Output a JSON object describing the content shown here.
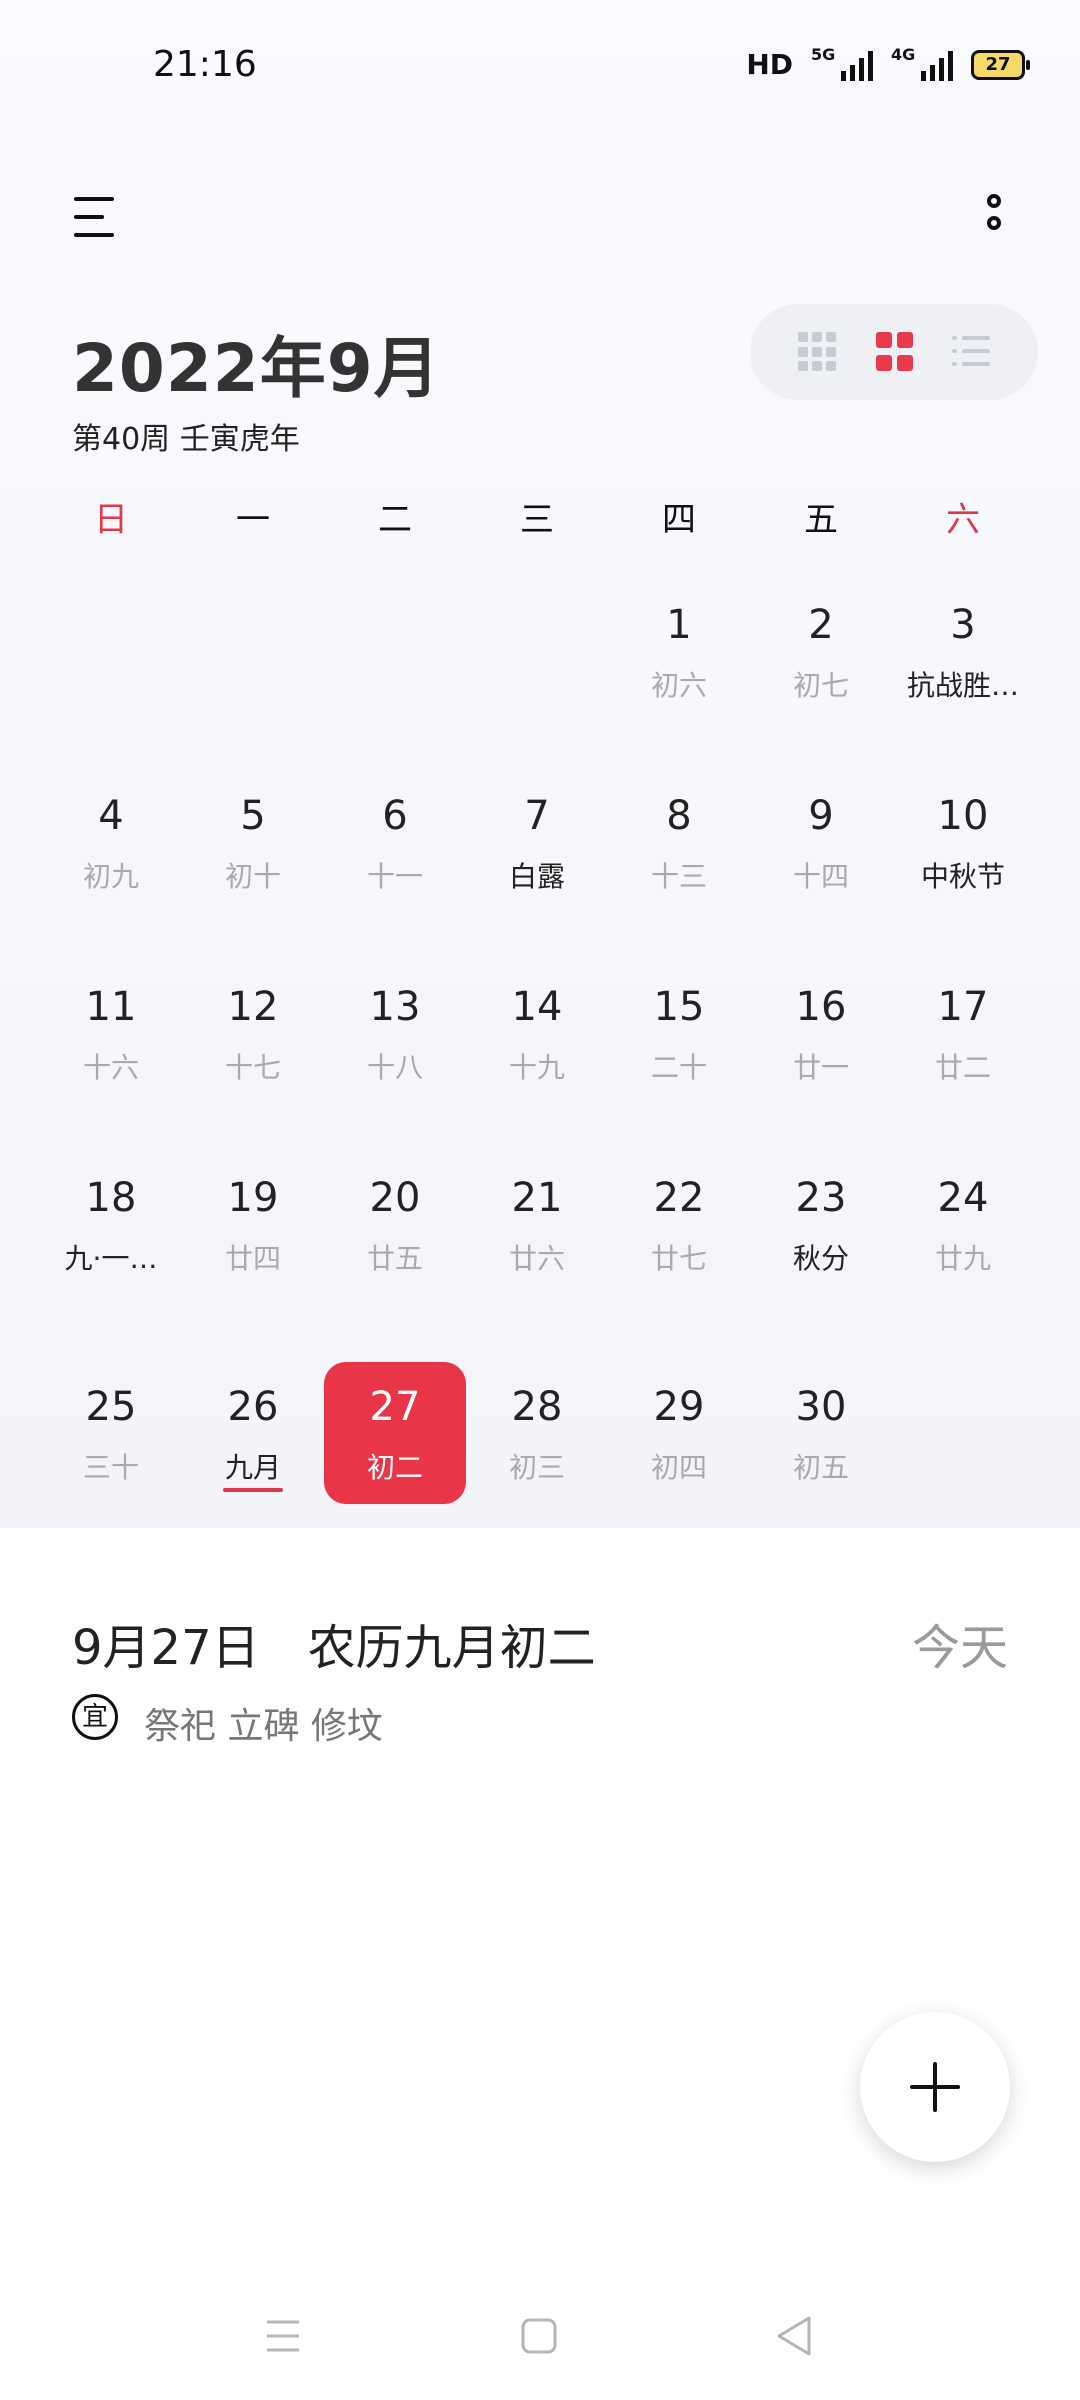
{
  "status_bar": {
    "time": "21:16",
    "hd_label": "HD",
    "net1": "5G",
    "net2": "4G",
    "battery": "27"
  },
  "header": {
    "month_title": "2022年9月",
    "subtitle": "第40周 壬寅虎年"
  },
  "weekdays": [
    "日",
    "一",
    "二",
    "三",
    "四",
    "五",
    "六"
  ],
  "calendar": {
    "rows": [
      [
        null,
        null,
        null,
        null,
        {
          "n": "1",
          "l": "初六"
        },
        {
          "n": "2",
          "l": "初七"
        },
        {
          "n": "3",
          "l": "抗战胜…",
          "hl": true
        }
      ],
      [
        {
          "n": "4",
          "l": "初九"
        },
        {
          "n": "5",
          "l": "初十"
        },
        {
          "n": "6",
          "l": "十一"
        },
        {
          "n": "7",
          "l": "白露",
          "hl": true
        },
        {
          "n": "8",
          "l": "十三"
        },
        {
          "n": "9",
          "l": "十四"
        },
        {
          "n": "10",
          "l": "中秋节",
          "hl": true
        }
      ],
      [
        {
          "n": "11",
          "l": "十六"
        },
        {
          "n": "12",
          "l": "十七"
        },
        {
          "n": "13",
          "l": "十八"
        },
        {
          "n": "14",
          "l": "十九"
        },
        {
          "n": "15",
          "l": "二十"
        },
        {
          "n": "16",
          "l": "廿一"
        },
        {
          "n": "17",
          "l": "廿二"
        }
      ],
      [
        {
          "n": "18",
          "l": "九·一…",
          "hl": true
        },
        {
          "n": "19",
          "l": "廿四"
        },
        {
          "n": "20",
          "l": "廿五"
        },
        {
          "n": "21",
          "l": "廿六"
        },
        {
          "n": "22",
          "l": "廿七"
        },
        {
          "n": "23",
          "l": "秋分",
          "hl": true
        },
        {
          "n": "24",
          "l": "廿九"
        }
      ],
      [
        {
          "n": "25",
          "l": "三十"
        },
        {
          "n": "26",
          "l": "九月",
          "hl": true,
          "underline": true
        },
        {
          "n": "27",
          "l": "初二",
          "selected": true
        },
        {
          "n": "28",
          "l": "初三"
        },
        {
          "n": "29",
          "l": "初四"
        },
        {
          "n": "30",
          "l": "初五"
        },
        null
      ]
    ]
  },
  "detail": {
    "date_text": "9月27日　农历九月初二",
    "today_button": "今天",
    "yi_badge": "宜",
    "yi_text": "祭祀 立碑 修坟"
  },
  "colors": {
    "accent": "#e83548",
    "weekend": "#e0394a",
    "muted": "#aaaaaa"
  }
}
